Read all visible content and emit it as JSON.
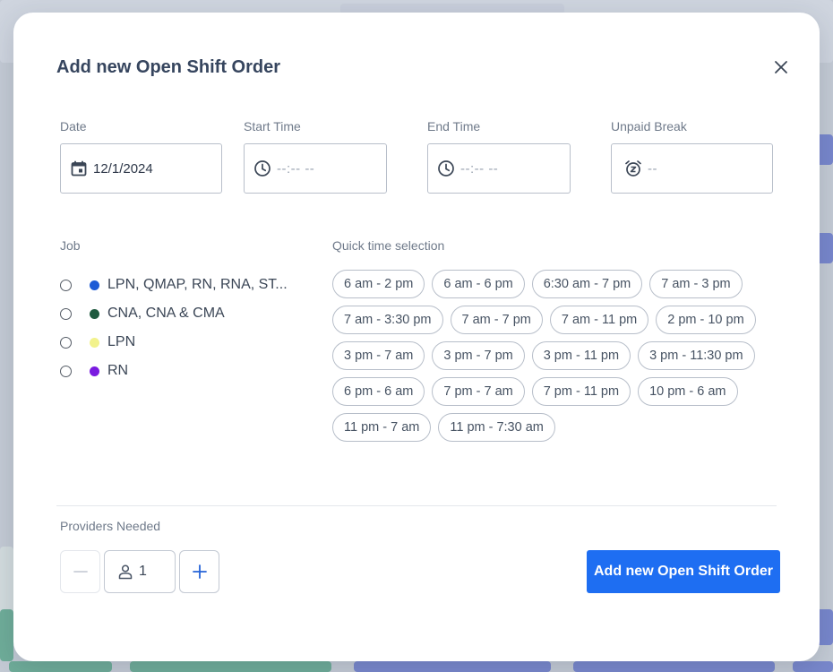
{
  "modal": {
    "title": "Add new Open Shift Order",
    "close_label": "×"
  },
  "fields": {
    "date": {
      "label": "Date",
      "value": "12/1/2024",
      "icon": "calendar-icon"
    },
    "start_time": {
      "label": "Start Time",
      "placeholder": "--:-- --",
      "icon": "clock-icon"
    },
    "end_time": {
      "label": "End Time",
      "placeholder": "--:-- --",
      "icon": "clock-icon"
    },
    "unpaid_break": {
      "label": "Unpaid Break",
      "placeholder": "--",
      "icon": "alarm-snooze-icon"
    }
  },
  "job": {
    "label": "Job",
    "options": [
      {
        "label": "LPN, QMAP, RN, RNA, ST...",
        "color": "#1d5bd6"
      },
      {
        "label": "CNA, CNA & CMA",
        "color": "#1f5a3f"
      },
      {
        "label": "LPN",
        "color": "#f2f28c"
      },
      {
        "label": "RN",
        "color": "#7a1be0"
      }
    ]
  },
  "quick_time": {
    "label": "Quick time selection",
    "options": [
      "6 am - 2 pm",
      "6 am - 6 pm",
      "6:30 am - 7 pm",
      "7 am - 3 pm",
      "7 am - 3:30 pm",
      "7 am - 7 pm",
      "7 am - 11 pm",
      "2 pm - 10 pm",
      "3 pm - 7 am",
      "3 pm - 7 pm",
      "3 pm - 11 pm",
      "3 pm - 11:30 pm",
      "6 pm - 6 am",
      "7 pm - 7 am",
      "7 pm - 11 pm",
      "10 pm - 6 am",
      "11 pm - 7 am",
      "11 pm - 7:30 am"
    ]
  },
  "providers": {
    "label": "Providers Needed",
    "value": "1",
    "minus_label": "−",
    "plus_label": "+"
  },
  "submit": {
    "label": "Add new Open Shift Order",
    "color": "#1e6ef2"
  }
}
